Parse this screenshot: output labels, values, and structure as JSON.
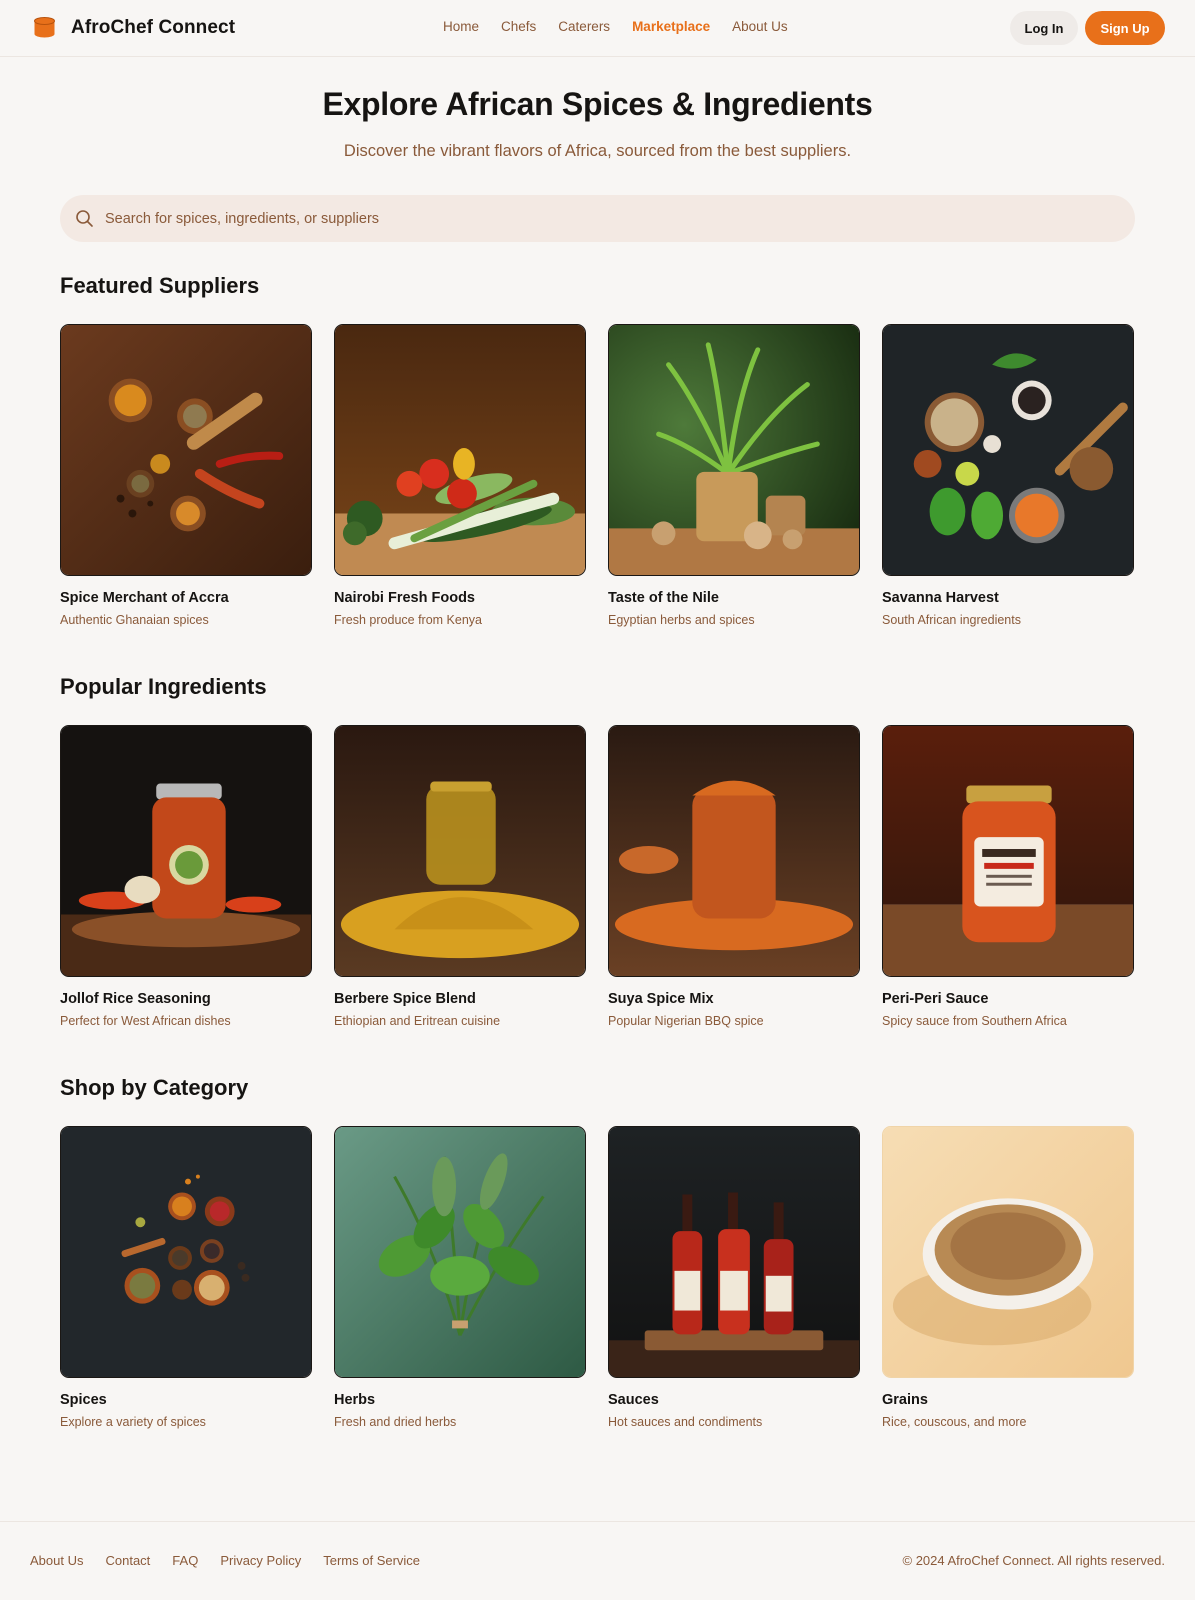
{
  "brand": {
    "name": "AfroChef Connect",
    "accent": "#e8701a"
  },
  "nav": [
    {
      "label": "Home",
      "active": false
    },
    {
      "label": "Chefs",
      "active": false
    },
    {
      "label": "Caterers",
      "active": false
    },
    {
      "label": "Marketplace",
      "active": true
    },
    {
      "label": "About Us",
      "active": false
    }
  ],
  "auth": {
    "login": "Log In",
    "signup": "Sign Up"
  },
  "hero": {
    "title": "Explore African Spices & Ingredients",
    "subtitle": "Discover the vibrant flavors of Africa, sourced from the best suppliers."
  },
  "search": {
    "placeholder": "Search for spices, ingredients, or suppliers",
    "value": "",
    "icon": "search-icon"
  },
  "sections": {
    "suppliers": {
      "title": "Featured Suppliers",
      "items": [
        {
          "title": "Spice Merchant of Accra",
          "desc": "Authentic Ghanaian spices",
          "image": "spices-on-wood-image"
        },
        {
          "title": "Nairobi Fresh Foods",
          "desc": "Fresh produce from Kenya",
          "image": "vegetables-image"
        },
        {
          "title": "Taste of the Nile",
          "desc": "Egyptian herbs and spices",
          "image": "potted-plant-image"
        },
        {
          "title": "Savanna Harvest",
          "desc": "South African ingredients",
          "image": "ingredients-flatlay-image"
        }
      ]
    },
    "ingredients": {
      "title": "Popular Ingredients",
      "items": [
        {
          "title": "Jollof Rice Seasoning",
          "desc": "Perfect for West African dishes",
          "image": "seasoning-jar-image"
        },
        {
          "title": "Berbere Spice Blend",
          "desc": "Ethiopian and Eritrean cuisine",
          "image": "spice-jar-image"
        },
        {
          "title": "Suya Spice Mix",
          "desc": "Popular Nigerian BBQ spice",
          "image": "suya-jar-image"
        },
        {
          "title": "Peri-Peri Sauce",
          "desc": "Spicy sauce from Southern Africa",
          "image": "sauce-jar-image"
        }
      ]
    },
    "categories": {
      "title": "Shop by Category",
      "items": [
        {
          "title": "Spices",
          "desc": "Explore a variety of spices",
          "image": "spice-bowls-image"
        },
        {
          "title": "Herbs",
          "desc": "Fresh and dried herbs",
          "image": "herbs-bunch-image"
        },
        {
          "title": "Sauces",
          "desc": "Hot sauces and condiments",
          "image": "hot-sauce-bottles-image"
        },
        {
          "title": "Grains",
          "desc": "Rice, couscous, and more",
          "image": "grain-bowl-image"
        }
      ]
    }
  },
  "footer": {
    "links": [
      "About Us",
      "Contact",
      "FAQ",
      "Privacy Policy",
      "Terms of Service"
    ],
    "copyright": "© 2024 AfroChef Connect. All rights reserved."
  }
}
